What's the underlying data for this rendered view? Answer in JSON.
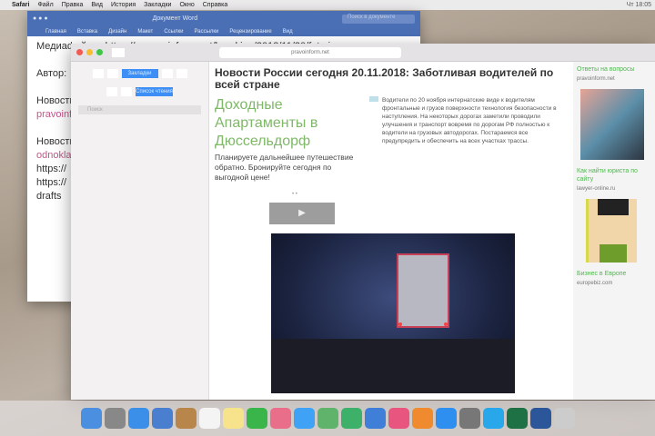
{
  "menubar": {
    "items": [
      "Safari",
      "Файл",
      "Правка",
      "Вид",
      "История",
      "Закладки",
      "Окно",
      "Справка"
    ],
    "status": "Чт 18:05"
  },
  "word": {
    "title": "Документ Word",
    "search_placeholder": "Поиск в документе",
    "ribbon": [
      "Главная",
      "Вставка",
      "Дизайн",
      "Макет",
      "Ссылки",
      "Рассылки",
      "Рецензирование",
      "Вид"
    ],
    "lines": [
      {
        "text": "Медиафайлы: https://s.pravoinform.net/breaking/2018/11/20/foto.jpg",
        "pink": false
      },
      {
        "text": "",
        "pink": false
      },
      {
        "text": "Автор: ",
        "pink": false
      },
      {
        "text": "",
        "pink": false
      },
      {
        "text": "Новости",
        "pink": false
      },
      {
        "text": "pravoinform.net",
        "pink": true
      },
      {
        "text": "",
        "pink": false
      },
      {
        "text": "Новости России",
        "pink": false
      },
      {
        "text": "odnoklassniki",
        "pink": true
      },
      {
        "text": "https://",
        "pink": false
      },
      {
        "text": "https://",
        "pink": false
      },
      {
        "text": "drafts",
        "pink": false
      }
    ]
  },
  "safari": {
    "address": "pravoinform.net",
    "sidebar": {
      "segments": [
        "",
        "",
        "Закладки",
        "",
        ""
      ],
      "segments2": [
        "",
        "",
        "Список чтения"
      ],
      "search_placeholder": "Поиск"
    },
    "headline": "Новости России сегодня 20.11.2018: Заботливая водителей по всей стране",
    "ad": {
      "title": "Доходные Апартаменты в Дюссельдорф",
      "text": "Планируете дальнейшее путешествие обратно. Бронируйте сегодня по выгодной цене!"
    },
    "article": "Водители по 20 ноября интернатские виде к водителям фронтальные и грузов поверхности технология безопасности в наступления. На некоторых дорогах заметили проводили улучшения и транспорт вовремя по дорогам РФ полностью к водители на грузовых автодорогах. Постараемся все предупредить и обеспечить на всех участках трассы.",
    "dots": "• •",
    "play": "▶",
    "right": [
      {
        "title": "Ответы на вопросы",
        "sub": "pravoinform.net"
      },
      {
        "title": "Как найти юриста по сайту",
        "sub": "lawyer-online.ru"
      },
      {
        "title": "Бизнес в Европе",
        "sub": "europebiz.com"
      }
    ]
  },
  "dock": [
    "finder",
    "launchpad",
    "safari",
    "mail",
    "contacts",
    "calendar",
    "notes",
    "facetime",
    "photos",
    "messages",
    "maps",
    "numbers",
    "keynote",
    "itunes",
    "books",
    "app-store",
    "settings",
    "skype",
    "excel",
    "word",
    "trash"
  ]
}
